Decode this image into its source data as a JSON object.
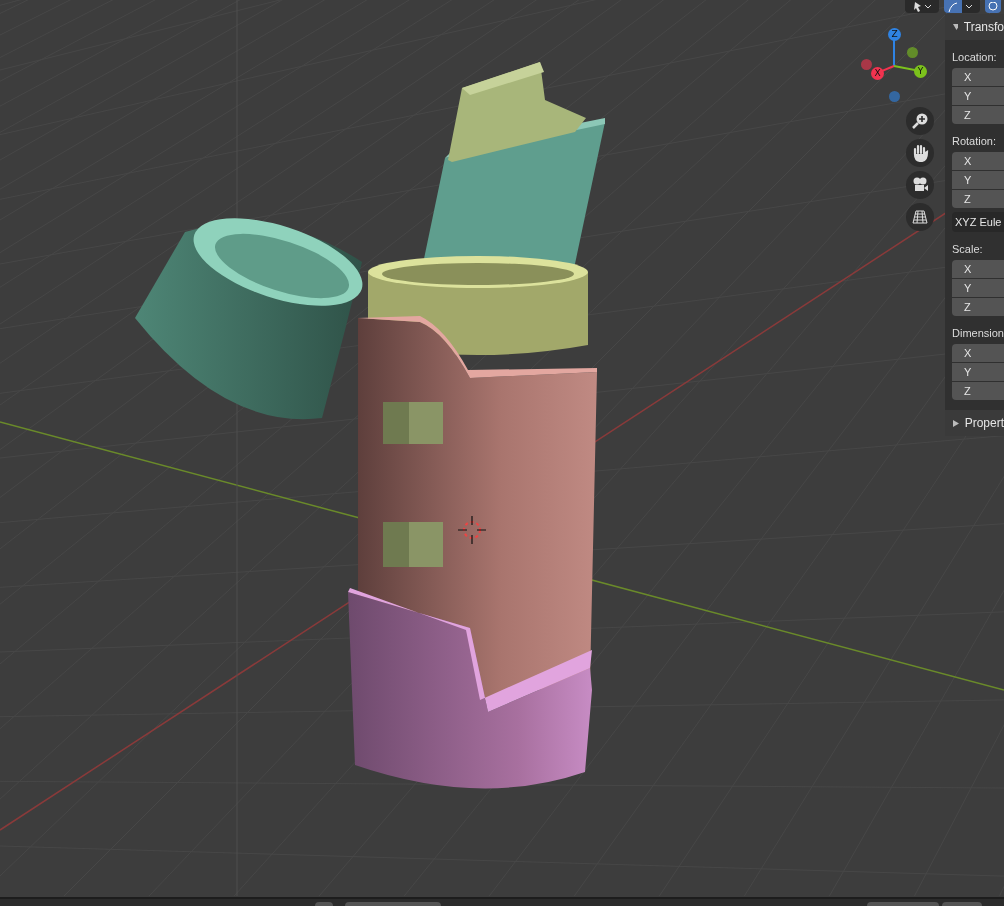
{
  "gizmo": {
    "axes": [
      {
        "label": "Z",
        "color": "#2f83e3"
      },
      {
        "label": "X",
        "color": "#f2334f"
      },
      {
        "label": "Y",
        "color": "#7cc21c"
      }
    ]
  },
  "panel": {
    "sections": [
      {
        "title": "Transfo",
        "expanded": true,
        "groups": [
          {
            "kind": "vector",
            "label": "Location:",
            "fields": [
              "X",
              "Y",
              "Z"
            ]
          },
          {
            "kind": "vector",
            "label": "Rotation:",
            "fields": [
              "X",
              "Y",
              "Z"
            ]
          },
          {
            "kind": "dropdown",
            "value": "XYZ Eule"
          },
          {
            "kind": "vector",
            "label": "Scale:",
            "fields": [
              "X",
              "Y",
              "Z"
            ]
          },
          {
            "kind": "vector",
            "label": "Dimension",
            "fields": [
              "X",
              "Y",
              "Z"
            ]
          }
        ]
      },
      {
        "title": "Propert",
        "expanded": false
      }
    ]
  }
}
